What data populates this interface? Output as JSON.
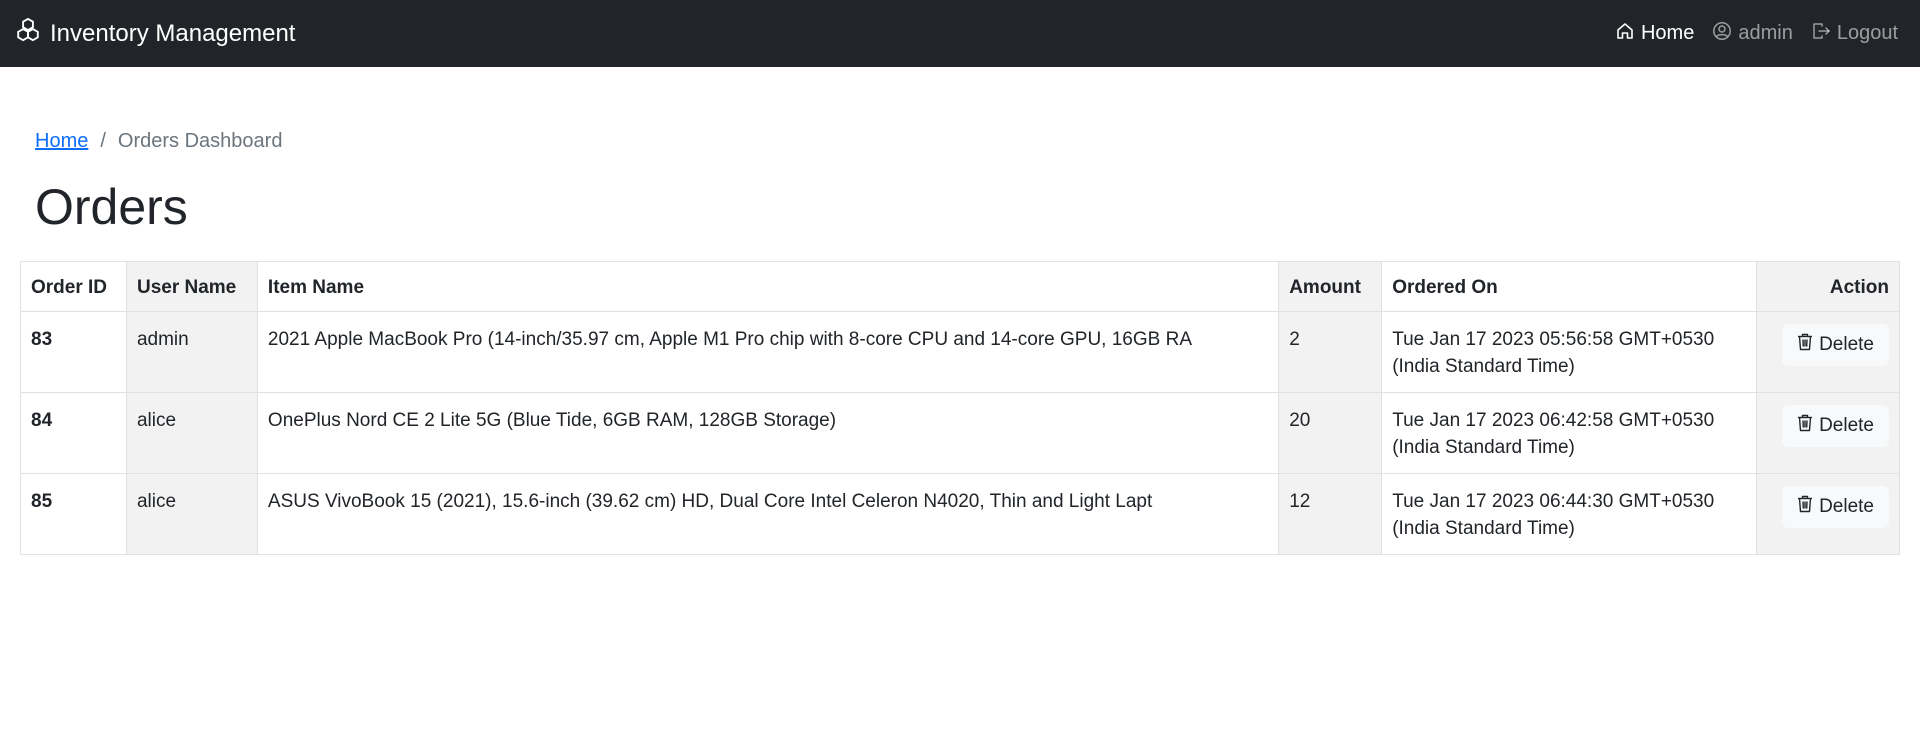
{
  "navbar": {
    "brand": "Inventory Management",
    "links": {
      "home": "Home",
      "user": "admin",
      "logout": "Logout"
    }
  },
  "breadcrumb": {
    "home": "Home",
    "separator": "/",
    "current": "Orders Dashboard"
  },
  "page_title": "Orders",
  "table": {
    "headers": {
      "order_id": "Order ID",
      "user_name": "User Name",
      "item_name": "Item Name",
      "amount": "Amount",
      "ordered_on": "Ordered On",
      "action": "Action"
    },
    "rows": [
      {
        "order_id": "83",
        "user_name": "admin",
        "item_name": "2021 Apple MacBook Pro (14-inch/35.97 cm, Apple M1 Pro chip with 8-core CPU and 14-core GPU, 16GB RA",
        "amount": "2",
        "ordered_on": "Tue Jan 17 2023 05:56:58 GMT+0530 (India Standard Time)",
        "action_label": "Delete"
      },
      {
        "order_id": "84",
        "user_name": "alice",
        "item_name": "OnePlus Nord CE 2 Lite 5G (Blue Tide, 6GB RAM, 128GB Storage)",
        "amount": "20",
        "ordered_on": "Tue Jan 17 2023 06:42:58 GMT+0530 (India Standard Time)",
        "action_label": "Delete"
      },
      {
        "order_id": "85",
        "user_name": "alice",
        "item_name": "ASUS VivoBook 15 (2021), 15.6-inch (39.62 cm) HD, Dual Core Intel Celeron N4020, Thin and Light Lapt",
        "amount": "12",
        "ordered_on": "Tue Jan 17 2023 06:44:30 GMT+0530 (India Standard Time)",
        "action_label": "Delete"
      }
    ]
  },
  "colors": {
    "navbar_bg": "#212529",
    "link": "#0d6efd",
    "shaded_column": "#f2f2f2"
  },
  "icons": {
    "brand": "boxes-icon",
    "home": "house-icon",
    "user": "person-circle-icon",
    "logout": "box-arrow-right-icon",
    "delete": "trash-icon"
  }
}
